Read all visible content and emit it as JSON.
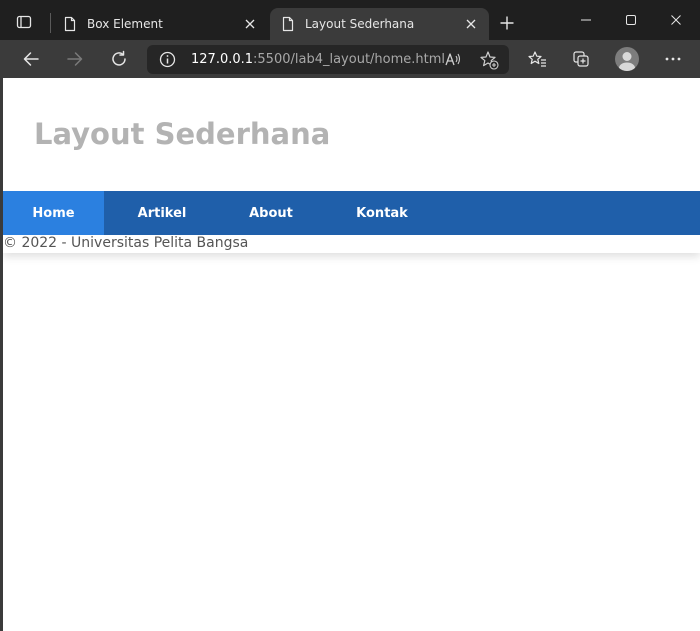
{
  "browser": {
    "tabs": [
      {
        "title": "Box Element",
        "active": false
      },
      {
        "title": "Layout Sederhana",
        "active": true
      }
    ],
    "address": {
      "host": "127.0.0.1",
      "path": ":5500/lab4_layout/home.html"
    },
    "colors": {
      "tabstrip": "#1f1f1f",
      "toolbar": "#3b3b3b",
      "addressbar": "#262626"
    }
  },
  "page": {
    "header_title": "Layout Sederhana",
    "nav": [
      {
        "label": "Home",
        "active": true
      },
      {
        "label": "Artikel",
        "active": false
      },
      {
        "label": "About",
        "active": false
      },
      {
        "label": "Kontak",
        "active": false
      }
    ],
    "footer_text": "© 2022 - Universitas Pelita Bangsa",
    "colors": {
      "nav_bg": "#1f5faa",
      "nav_active": "#2b80e0",
      "title": "#b3b3b3"
    }
  },
  "icons": {
    "tab_actions": "tab-actions-icon",
    "page": "page-icon",
    "close": "close-icon",
    "new_tab": "plus-icon",
    "back": "back-arrow-icon",
    "forward": "forward-arrow-icon",
    "refresh": "refresh-icon",
    "info": "info-icon",
    "read_aloud": "read-aloud-icon",
    "add_favorite": "add-favorite-icon",
    "favorites": "favorites-icon",
    "collections": "collections-icon",
    "profile": "profile-avatar",
    "more": "more-icon"
  }
}
